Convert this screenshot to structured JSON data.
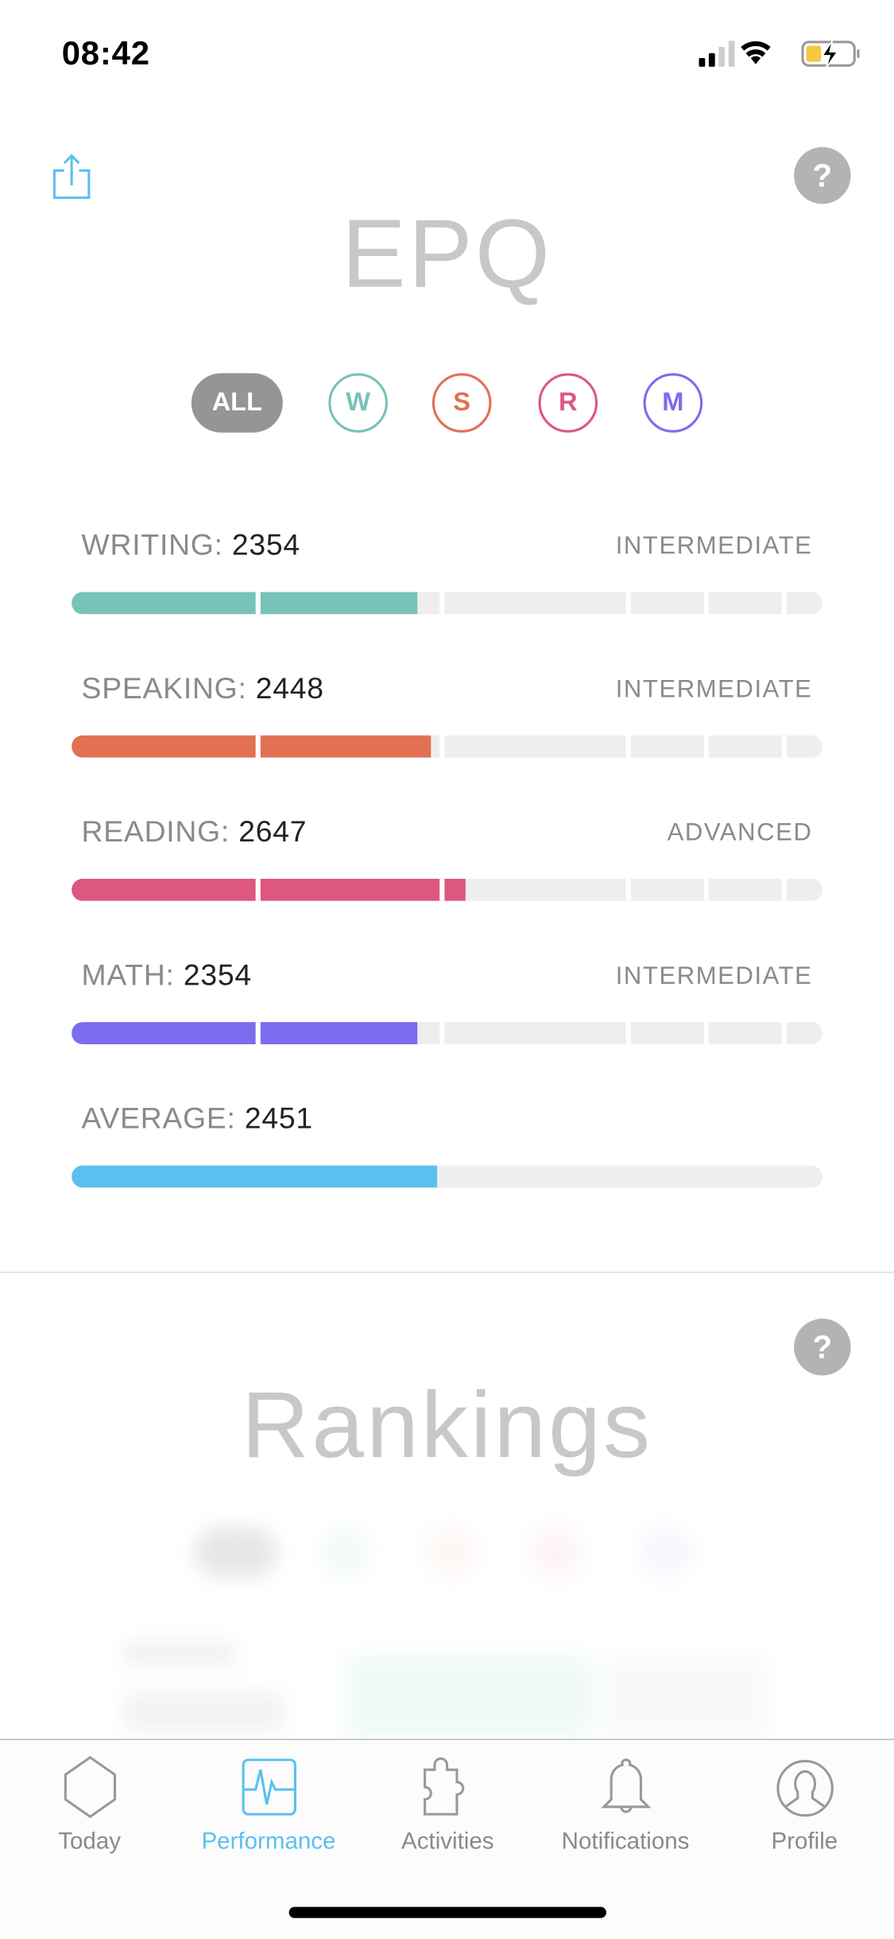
{
  "status_bar": {
    "time": "08:42",
    "battery_color": "#f5c842"
  },
  "epq": {
    "title": "EPQ",
    "filters": [
      {
        "label": "ALL",
        "color": "#959595",
        "selected": true
      },
      {
        "label": "W",
        "color": "#77c2b9",
        "selected": false
      },
      {
        "label": "S",
        "color": "#e27053",
        "selected": false
      },
      {
        "label": "R",
        "color": "#de5780",
        "selected": false
      },
      {
        "label": "M",
        "color": "#7b6cf0",
        "selected": false
      }
    ],
    "rows": [
      {
        "label": "WRITING:",
        "value": "2354",
        "level": "INTERMEDIATE",
        "color": "#77c2b9",
        "progress": 0.46
      },
      {
        "label": "SPEAKING:",
        "value": "2448",
        "level": "INTERMEDIATE",
        "color": "#e27053",
        "progress": 0.479
      },
      {
        "label": "READING:",
        "value": "2647",
        "level": "ADVANCED",
        "color": "#de5780",
        "progress": 0.524
      },
      {
        "label": "MATH:",
        "value": "2354",
        "level": "INTERMEDIATE",
        "color": "#7b6cf0",
        "progress": 0.46
      },
      {
        "label": "AVERAGE:",
        "value": "2451",
        "level": "",
        "color": "#5bc0f0",
        "progress": 0.487
      }
    ]
  },
  "rankings": {
    "title": "Rankings"
  },
  "help_label": "?",
  "tabs": [
    {
      "label": "Today",
      "icon": "hexagon-icon",
      "active": false
    },
    {
      "label": "Performance",
      "icon": "heartbeat-monitor-icon",
      "active": true
    },
    {
      "label": "Activities",
      "icon": "puzzle-icon",
      "active": false
    },
    {
      "label": "Notifications",
      "icon": "bell-icon",
      "active": false
    },
    {
      "label": "Profile",
      "icon": "profile-icon",
      "active": false
    }
  ],
  "accent_color": "#5bc0f0"
}
